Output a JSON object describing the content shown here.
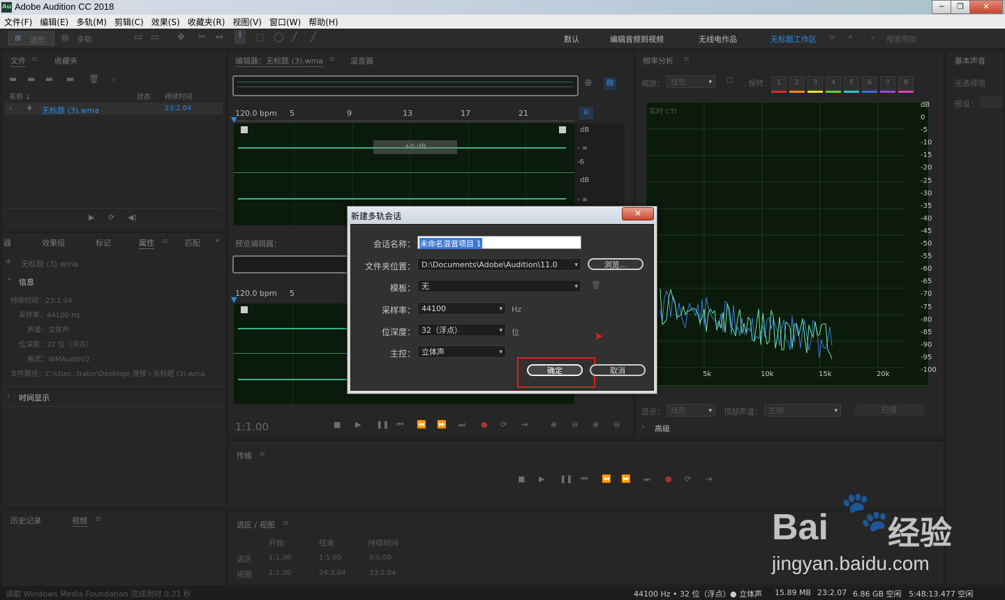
{
  "window": {
    "title": "Adobe Audition CC 2018",
    "app_badge": "Au",
    "buttons": [
      "─",
      "❐",
      "✕"
    ]
  },
  "menu": [
    "文件(F)",
    "编辑(E)",
    "多轨(M)",
    "剪辑(C)",
    "效果(S)",
    "收藏夹(R)",
    "视图(V)",
    "窗口(W)",
    "帮助(H)"
  ],
  "toolbar": {
    "mode_waveform": "波形",
    "mode_multitrack": "多轨",
    "workspaces": [
      "默认",
      "编辑音频到视频",
      "无线电作品",
      "无标题工作区"
    ],
    "active_workspace": "无标题工作区",
    "search_placeholder": "搜索帮助"
  },
  "files_panel": {
    "tabs": [
      "文件",
      "收藏夹"
    ],
    "col_name": "名称 ↓",
    "col_status": "状态",
    "col_duration": "持续时间",
    "file_name": "无标题 (3).wma",
    "file_duration": "23:2.04"
  },
  "props_panel": {
    "tabs": [
      "器",
      "效果组",
      "标记",
      "属性",
      "匹配"
    ],
    "active_tab": "属性",
    "file": "无标题 (3).wma",
    "section_info": "信息",
    "info": [
      "持续时间：23:2.04",
      "采样率：44100 Hz",
      "声道：立体声",
      "位深度：32 位（浮点）",
      "格式：WMAudioV2",
      "文件路径：C:\\User...trator\\Desktop\\ 音频 \\ 无标题 (3).wma"
    ],
    "section_time": "时间显示"
  },
  "history_panel": {
    "tabs": [
      "历史记录",
      "视频"
    ]
  },
  "editor": {
    "tab_editor": "编辑器：无标题 (3).wma",
    "tab_mixer": "混音器",
    "bpm": "120.0 bpm",
    "ruler": [
      "5",
      "9",
      "13",
      "17",
      "21"
    ],
    "db_label": "dB",
    "db_inf": "- ∞",
    "db_neg6": "-6",
    "hud": "+0 dB",
    "preview_title": "预览编辑器：",
    "preview_bpm": "120.0 bpm",
    "preview_ruler_5": "5",
    "time_display": "1:1.00"
  },
  "transport": {
    "title": "传输"
  },
  "selection": {
    "title": "选区 / 视图",
    "col_start": "开始",
    "col_end": "结束",
    "col_duration": "持续时间",
    "rows": [
      {
        "label": "选区",
        "start": "1:1.00",
        "end": "1:1.00",
        "duration": "0:0.00"
      },
      {
        "label": "视图",
        "start": "1:1.00",
        "end": "24:3.04",
        "duration": "23:2.04"
      }
    ]
  },
  "freq": {
    "title": "频率分析",
    "scale_label": "缩放：",
    "scale_value": "线性",
    "hold_label": "保持：",
    "hold_buttons": [
      "1",
      "2",
      "3",
      "4",
      "5",
      "6",
      "7",
      "8"
    ],
    "hold_colors": [
      "#e02b2b",
      "#f08a1c",
      "#f3e32b",
      "#69d23a",
      "#2ec6c8",
      "#3770e8",
      "#a346e3",
      "#e640b8"
    ],
    "realtime": "实时 CTI",
    "db_ticks": [
      "dB",
      "0",
      "-5",
      "-10",
      "-15",
      "-20",
      "-25",
      "-30",
      "-35",
      "-40",
      "-45",
      "-50",
      "-55",
      "-60",
      "-65",
      "-70",
      "-75",
      "-80",
      "-85",
      "-90",
      "-95",
      "-100"
    ],
    "hz_ticks": [
      "5k",
      "10k",
      "15k",
      "20k"
    ],
    "display_label": "显示：",
    "display_value": "线形",
    "top_channel_label": "顶部声道：",
    "top_channel_value": "左侧",
    "scan": "扫描",
    "advanced": "高级"
  },
  "essential": {
    "title": "基本声音",
    "no_selection": "无选择项",
    "preset_label": "预设："
  },
  "dialog": {
    "title": "新建多轨会话",
    "close": "✕",
    "session_name_label": "会话名称：",
    "session_name_value": "未命名混音项目 1",
    "folder_label": "文件夹位置：",
    "folder_value": "D:\\Documents\\Adobe\\Audition\\11.0",
    "browse": "浏览...",
    "template_label": "模板：",
    "template_value": "无",
    "sample_rate_label": "采样率：",
    "sample_rate_value": "44100",
    "sample_rate_unit": "Hz",
    "bit_depth_label": "位深度：",
    "bit_depth_value": "32（浮点）",
    "bit_depth_unit": "位",
    "master_label": "主控：",
    "master_value": "立体声",
    "ok": "确定",
    "cancel": "取消",
    "highlight_color": "#e02020"
  },
  "watermark": {
    "brand": "Bai",
    "brand2": "du",
    "cn": "经验",
    "url": "jingyan.baidu.com"
  },
  "status": {
    "left": "读取 Windows Media Foundation 完成用时 0.21 秒",
    "right": [
      "44100 Hz • 32 位（浮点）",
      "● 立体声",
      "15.89 MB",
      "23:2.07",
      "6.86 GB 空闲",
      "5:48:13.477 空闲"
    ]
  }
}
